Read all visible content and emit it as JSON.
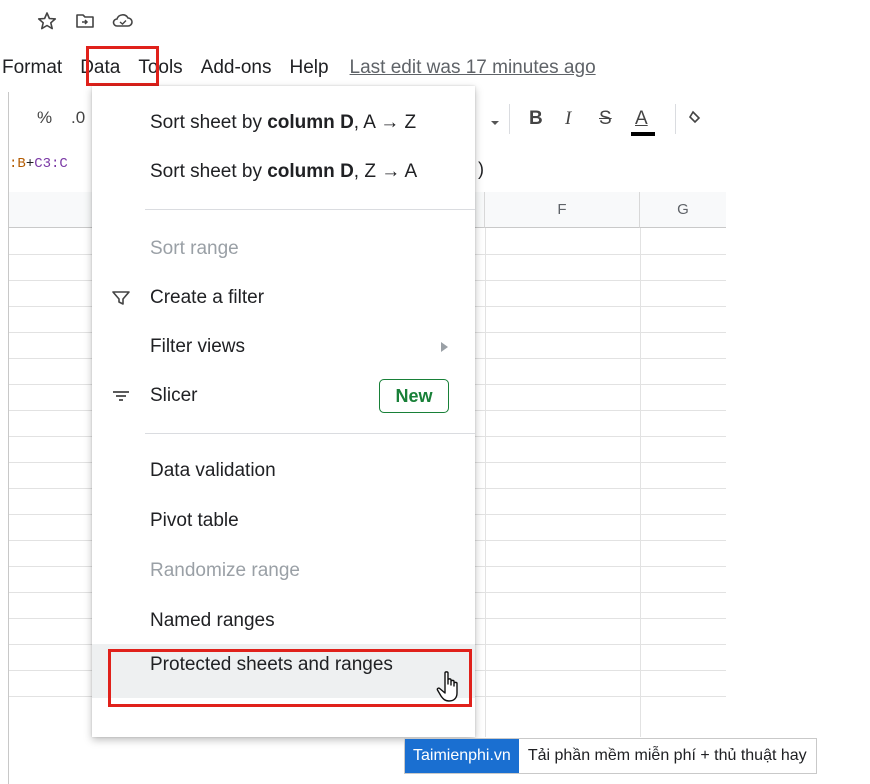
{
  "top_icons": [
    "star-icon",
    "move-to-folder-icon",
    "cloud-status-icon"
  ],
  "menubar": {
    "items": [
      "Format",
      "Data",
      "Tools",
      "Add-ons",
      "Help"
    ],
    "last_edit": "Last edit was 17 minutes ago"
  },
  "toolbar": {
    "percent": "%",
    "decimal": ".0",
    "bold": "B",
    "italic": "I",
    "strike": "S",
    "text_color": "A"
  },
  "formula": {
    "part1": ":B",
    "plus": "+",
    "part2": "C3:C",
    "close_paren": ")"
  },
  "columns": [
    "F",
    "G"
  ],
  "data_menu": {
    "items": [
      {
        "id": "sort-az",
        "pre": "Sort sheet by ",
        "bold": "column D",
        "post": ", A → Z"
      },
      {
        "id": "sort-za",
        "pre": "Sort sheet by ",
        "bold": "column D",
        "post": ", Z → A"
      },
      {
        "id": "sort-range",
        "label": "Sort range",
        "disabled": true
      },
      {
        "id": "create-filter",
        "label": "Create a filter",
        "icon": "filter-icon"
      },
      {
        "id": "filter-views",
        "label": "Filter views",
        "submenu": true
      },
      {
        "id": "slicer",
        "label": "Slicer",
        "icon": "slicer-icon",
        "badge": "New"
      },
      {
        "id": "data-validation",
        "label": "Data validation"
      },
      {
        "id": "pivot-table",
        "label": "Pivot table"
      },
      {
        "id": "randomize-range",
        "label": "Randomize range",
        "disabled": true
      },
      {
        "id": "named-ranges",
        "label": "Named ranges"
      },
      {
        "id": "protected-sheets",
        "label": "Protected sheets and ranges",
        "highlighted": true
      }
    ]
  },
  "footer": {
    "brand": "Taimienphi.vn",
    "tagline": "Tải phần mềm miễn phí + thủ thuật hay"
  },
  "colors": {
    "highlight_box": "#e0211b",
    "new_badge": "#188038",
    "brand_blue": "#1a6fd1"
  }
}
